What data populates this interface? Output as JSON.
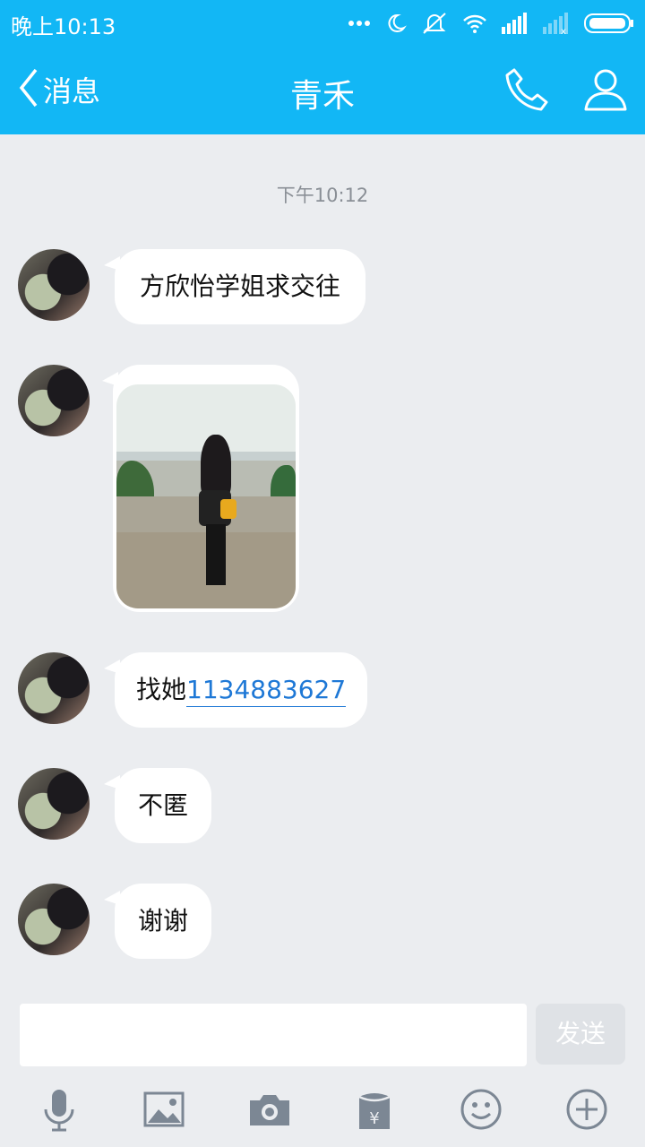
{
  "status_bar": {
    "time": "晚上10:13",
    "icons": [
      "more-dots-icon",
      "moon-icon",
      "mute-icon",
      "wifi-icon",
      "signal-icon",
      "signal-empty-icon",
      "battery-icon"
    ]
  },
  "header": {
    "back_label": "消息",
    "title": "青禾",
    "icons": [
      "phone-icon",
      "profile-icon"
    ]
  },
  "chat": {
    "timestamp": "下午10:12",
    "messages": [
      {
        "type": "text",
        "text": "方欣怡学姐求交往"
      },
      {
        "type": "image"
      },
      {
        "type": "text",
        "prefix": "找她",
        "link": "1134883627"
      },
      {
        "type": "text",
        "text": "不匿"
      },
      {
        "type": "text",
        "text": "谢谢"
      }
    ]
  },
  "input_bar": {
    "placeholder": "",
    "send_label": "发送"
  },
  "toolbar": {
    "items": [
      "microphone-icon",
      "image-icon",
      "camera-icon",
      "red-packet-icon",
      "emoji-icon",
      "plus-icon"
    ]
  },
  "colors": {
    "header_bg": "#12b7f5",
    "chat_bg": "#ebedf0",
    "link": "#1e78d6"
  }
}
